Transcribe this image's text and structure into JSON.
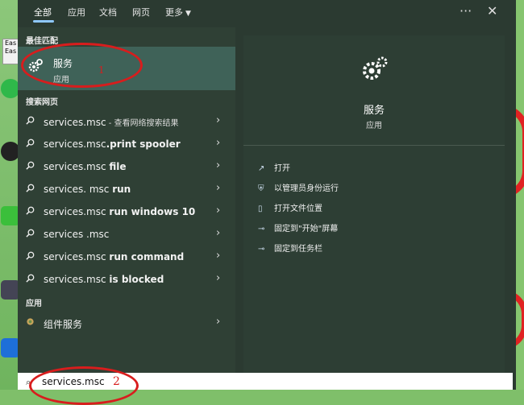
{
  "tabs": [
    "全部",
    "应用",
    "文档",
    "网页",
    "更多"
  ],
  "best_match": {
    "section": "最佳匹配",
    "title": "服务",
    "subtitle": "应用"
  },
  "web_section": "搜索网页",
  "web_results": [
    {
      "pre": "services.msc",
      "bold": "",
      "suffix": " - 查看网络搜索结果"
    },
    {
      "pre": "services.msc",
      "bold": ".print spooler",
      "suffix": ""
    },
    {
      "pre": "services.msc ",
      "bold": "file",
      "suffix": ""
    },
    {
      "pre": "services. msc ",
      "bold": "run",
      "suffix": ""
    },
    {
      "pre": "services.msc ",
      "bold": "run windows 10",
      "suffix": ""
    },
    {
      "pre": "services .msc",
      "bold": "",
      "suffix": ""
    },
    {
      "pre": "services.msc ",
      "bold": "run command",
      "suffix": ""
    },
    {
      "pre": "services.msc ",
      "bold": "is blocked",
      "suffix": ""
    }
  ],
  "apps_section": "应用",
  "app_results": [
    {
      "label": "组件服务"
    }
  ],
  "detail": {
    "title": "服务",
    "subtitle": "应用",
    "actions": [
      "打开",
      "以管理员身份运行",
      "打开文件位置",
      "固定到\"开始\"屏幕",
      "固定到任务栏"
    ]
  },
  "search": {
    "value": "services.msc"
  },
  "annotations": {
    "step1": "1",
    "step2": "2"
  },
  "colors": {
    "panel": "#2b3a31",
    "highlight": "#3f6258",
    "annotation": "#d81d1d",
    "tab_underline": "#8fc8ff"
  },
  "icons": [
    "gear-icon",
    "search-icon",
    "chevron-right-icon",
    "more-icon",
    "close-icon"
  ]
}
